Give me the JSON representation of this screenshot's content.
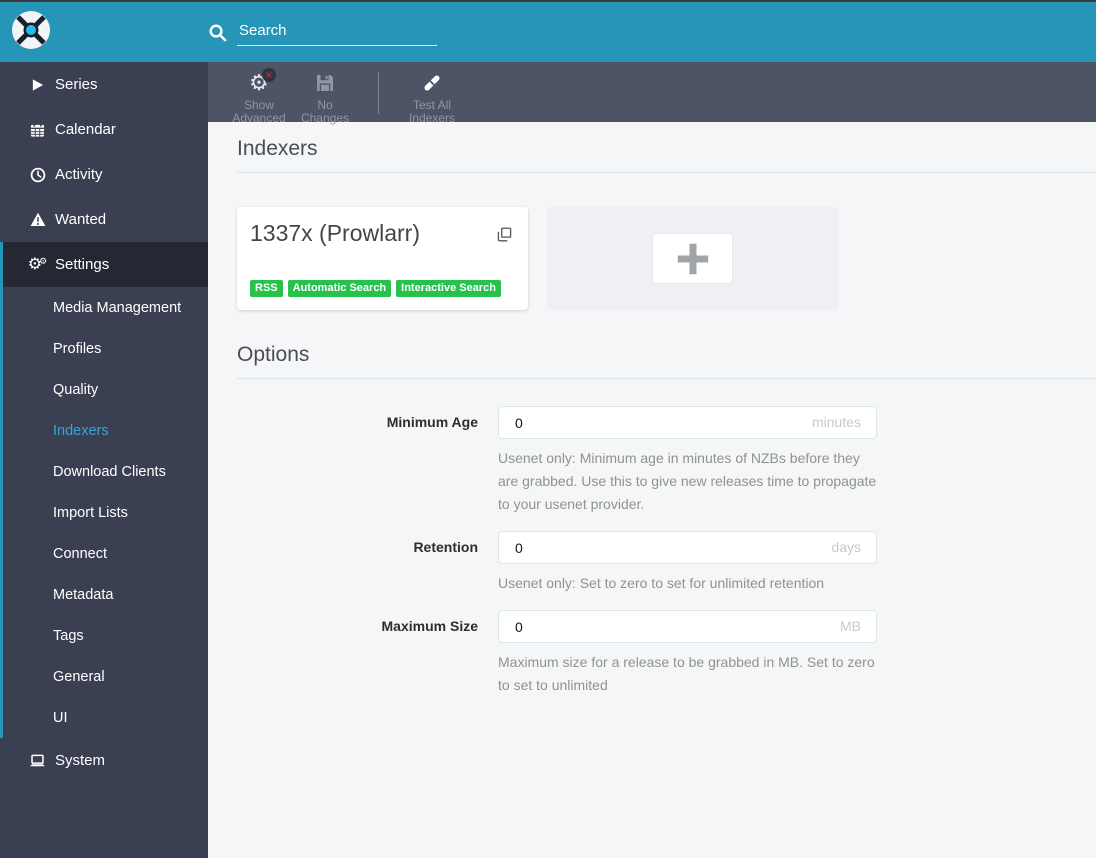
{
  "header": {
    "search": {
      "placeholder": "Search"
    }
  },
  "toolbar": {
    "buttons": [
      {
        "label": "Show Advanced",
        "icon": "advanced-gear-icon"
      },
      {
        "label": "No Changes",
        "icon": "save-icon"
      },
      {
        "label": "Test All Indexers",
        "icon": "test-vial-icon"
      }
    ]
  },
  "sidebar": {
    "items": [
      {
        "label": "Series",
        "icon": "play-icon"
      },
      {
        "label": "Calendar",
        "icon": "calendar-icon"
      },
      {
        "label": "Activity",
        "icon": "clock-icon"
      },
      {
        "label": "Wanted",
        "icon": "warning-icon"
      },
      {
        "label": "Settings",
        "icon": "gears-icon",
        "active": true
      },
      {
        "label": "System",
        "icon": "computer-icon"
      }
    ],
    "settings_children": [
      "Media Management",
      "Profiles",
      "Quality",
      "Indexers",
      "Download Clients",
      "Import Lists",
      "Connect",
      "Metadata",
      "Tags",
      "General",
      "UI"
    ],
    "selected_child": "Indexers"
  },
  "content": {
    "sections": [
      {
        "legend": "Indexers"
      },
      {
        "legend": "Options"
      }
    ],
    "indexer_card": {
      "title": "1337x (Prowlarr)",
      "tags": [
        "RSS",
        "Automatic Search",
        "Interactive Search"
      ],
      "clone_icon": "clone-icon"
    },
    "add_card": {
      "icon": "plus-icon"
    },
    "form": {
      "rows": [
        {
          "label": "Minimum Age",
          "value": "0",
          "unit": "minutes",
          "help": "Usenet only: Minimum age in minutes of NZBs before they are grabbed. Use this to give new releases time to propagate to your usenet provider."
        },
        {
          "label": "Retention",
          "value": "0",
          "unit": "days",
          "help": "Usenet only: Set to zero to set for unlimited retention"
        },
        {
          "label": "Maximum Size",
          "value": "0",
          "unit": "MB",
          "help": "Maximum size for a release to be grabbed in MB. Set to zero to set to unlimited"
        }
      ]
    }
  },
  "colors": {
    "header_teal": "#2595b8",
    "toolbar_slate": "#4e5465",
    "sidebar_dark": "#3a3f51",
    "sidebar_active_bg": "#252833",
    "selected_link_blue": "#3da2dc",
    "tag_green": "#27c24c",
    "content_bg": "#f5f6f8"
  }
}
